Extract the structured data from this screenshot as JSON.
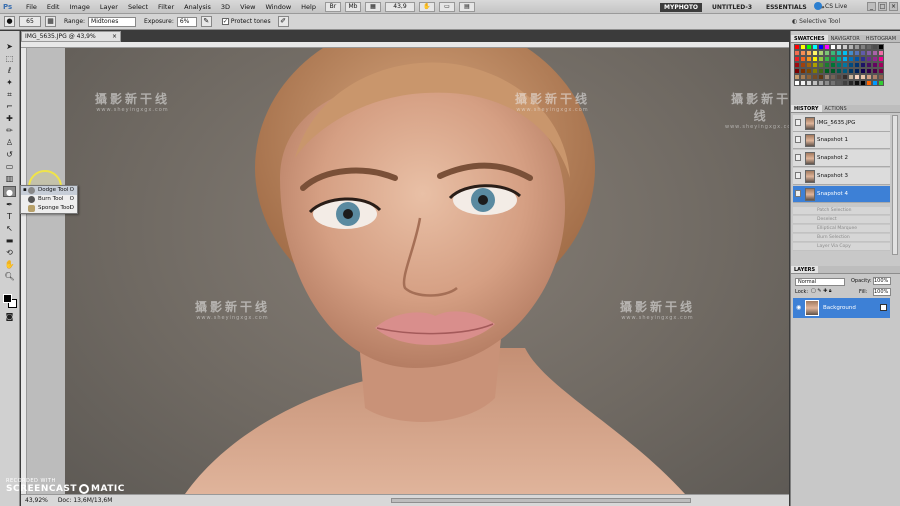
{
  "app": {
    "logo": "Ps"
  },
  "menu": [
    "File",
    "Edit",
    "Image",
    "Layer",
    "Select",
    "Filter",
    "Analysis",
    "3D",
    "View",
    "Window",
    "Help"
  ],
  "menu_zoom": "43,9",
  "workspaces": [
    "MYPHOTO",
    "UNTITLED-3",
    "ESSENTIALS"
  ],
  "workspace_more": "»",
  "cslive": "CS Live",
  "options": {
    "brush_size": "65",
    "range_label": "Range:",
    "range_value": "Midtones",
    "exposure_label": "Exposure:",
    "exposure_value": "6%",
    "protect_tones": "Protect tones",
    "protect_checked": true
  },
  "tool_ticker": "Selective Tool",
  "document": {
    "tab_title": "IMG_5635.JPG @ 43,9% (RGB/8)",
    "close": "×",
    "watermark_cn": "攝影新干线",
    "watermark_sub": "www.sheyingxgx.com"
  },
  "status": {
    "zoom": "43,92%",
    "doc": "Doc: 13,6M/13,6M"
  },
  "flyout": [
    {
      "label": "Dodge Tool",
      "key": "O",
      "selected": true
    },
    {
      "label": "Burn Tool",
      "key": "O",
      "selected": false
    },
    {
      "label": "Sponge Tool",
      "key": "O",
      "selected": false
    }
  ],
  "panels": {
    "swatch_tabs": [
      "SWATCHES",
      "NAVIGATOR",
      "HISTOGRAM"
    ],
    "history_tabs": [
      "HISTORY",
      "ACTIONS"
    ],
    "history_items": [
      "IMG_5635.JPG",
      "Snapshot 1",
      "Snapshot 2",
      "Snapshot 3",
      "Snapshot 4"
    ],
    "history_selected": 4,
    "history_steps": [
      "Patch Selection",
      "Deselect",
      "Elliptical Marquee",
      "Burn Selection",
      "Layer Via Copy"
    ],
    "layers_tabs": [
      "LAYERS"
    ],
    "blend_mode": "Normal",
    "opacity_label": "Opacity:",
    "opacity_value": "100%",
    "lock_label": "Lock:",
    "fill_label": "Fill:",
    "fill_value": "100%",
    "layer_name": "Background"
  },
  "recorder": {
    "recorded_with": "RECORDED WITH",
    "brand_left": "SCREENCAST",
    "brand_right": "MATIC"
  },
  "swatch_colors": [
    "#ff0000",
    "#ffff00",
    "#00ff00",
    "#00ffff",
    "#0000ff",
    "#ff00ff",
    "#ffffff",
    "#e5e5e5",
    "#cccccc",
    "#b3b3b3",
    "#999999",
    "#808080",
    "#666666",
    "#4d4d4d",
    "#000000",
    "#f26c4f",
    "#f68e55",
    "#fbaf5c",
    "#fff467",
    "#acd372",
    "#7cc576",
    "#3bb878",
    "#1abbb4",
    "#00bff3",
    "#438cca",
    "#5574b9",
    "#605ca8",
    "#855fa8",
    "#a763a8",
    "#f06ea9",
    "#ed1c24",
    "#f26522",
    "#f7941d",
    "#fff200",
    "#8dc73f",
    "#39b54a",
    "#00a651",
    "#00a99d",
    "#00aeef",
    "#0072bc",
    "#0054a6",
    "#2e3192",
    "#662d91",
    "#92278f",
    "#ec008c",
    "#9e0b0f",
    "#a0410d",
    "#a36209",
    "#aba000",
    "#598527",
    "#1a7b30",
    "#007236",
    "#00746b",
    "#0076a3",
    "#004b80",
    "#003471",
    "#1b1464",
    "#440e62",
    "#630460",
    "#9e005d",
    "#790000",
    "#7b2e00",
    "#7d4900",
    "#827b00",
    "#406618",
    "#005e20",
    "#005826",
    "#005952",
    "#005b7f",
    "#003663",
    "#002157",
    "#0d004c",
    "#32004b",
    "#4b0049",
    "#7b0046",
    "#c69c6d",
    "#a67c52",
    "#8c6239",
    "#754c24",
    "#603913",
    "#998675",
    "#736357",
    "#534741",
    "#362f2d",
    "#c7b299",
    "#f7d5c2",
    "#eac4a8",
    "#d3a185",
    "#ad7f68",
    "#8b5e4a",
    "#ffffff",
    "#f2f2f2",
    "#d9d9d9",
    "#bfbfbf",
    "#a6a6a6",
    "#8c8c8c",
    "#737373",
    "#595959",
    "#404040",
    "#262626",
    "#0d0d0d",
    "#000000",
    "#ff6600",
    "#0099ff",
    "#33cc33"
  ]
}
